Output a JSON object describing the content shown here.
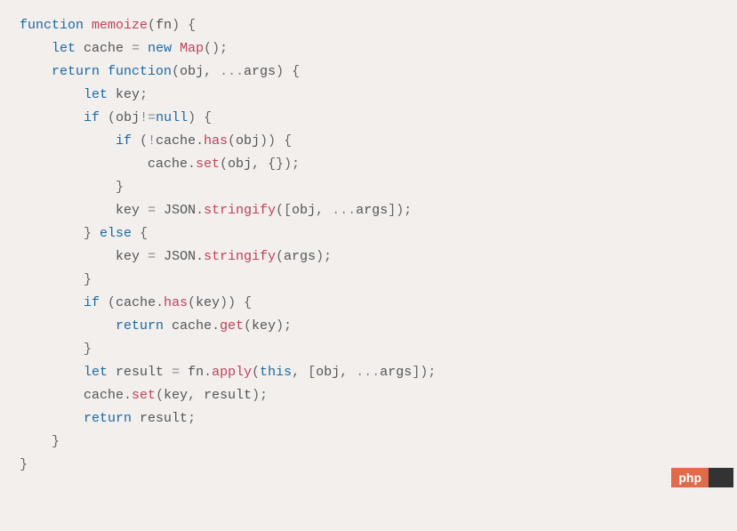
{
  "code": {
    "l1_function": "function",
    "l1_name": "memoize",
    "l1_param": "fn",
    "l2_let": "let",
    "l2_cache": "cache",
    "l2_new": "new",
    "l2_map": "Map",
    "l3_return": "return",
    "l3_function": "function",
    "l3_obj": "obj",
    "l3_args": "args",
    "l4_let": "let",
    "l4_key": "key",
    "l5_if": "if",
    "l5_obj": "obj",
    "l5_null": "null",
    "l6_if": "if",
    "l6_cache": "cache",
    "l6_has": "has",
    "l6_obj": "obj",
    "l7_cache": "cache",
    "l7_set": "set",
    "l7_obj": "obj",
    "l9_key": "key",
    "l9_json": "JSON",
    "l9_stringify": "stringify",
    "l9_obj": "obj",
    "l9_args": "args",
    "l10_else": "else",
    "l11_key": "key",
    "l11_json": "JSON",
    "l11_stringify": "stringify",
    "l11_args": "args",
    "l13_if": "if",
    "l13_cache": "cache",
    "l13_has": "has",
    "l13_key": "key",
    "l14_return": "return",
    "l14_cache": "cache",
    "l14_get": "get",
    "l14_key": "key",
    "l16_let": "let",
    "l16_result": "result",
    "l16_fn": "fn",
    "l16_apply": "apply",
    "l16_this": "this",
    "l16_obj": "obj",
    "l16_args": "args",
    "l17_cache": "cache",
    "l17_set": "set",
    "l17_key": "key",
    "l17_result": "result",
    "l18_return": "return",
    "l18_result": "result"
  },
  "watermark": {
    "left": "php",
    "right": "  "
  }
}
